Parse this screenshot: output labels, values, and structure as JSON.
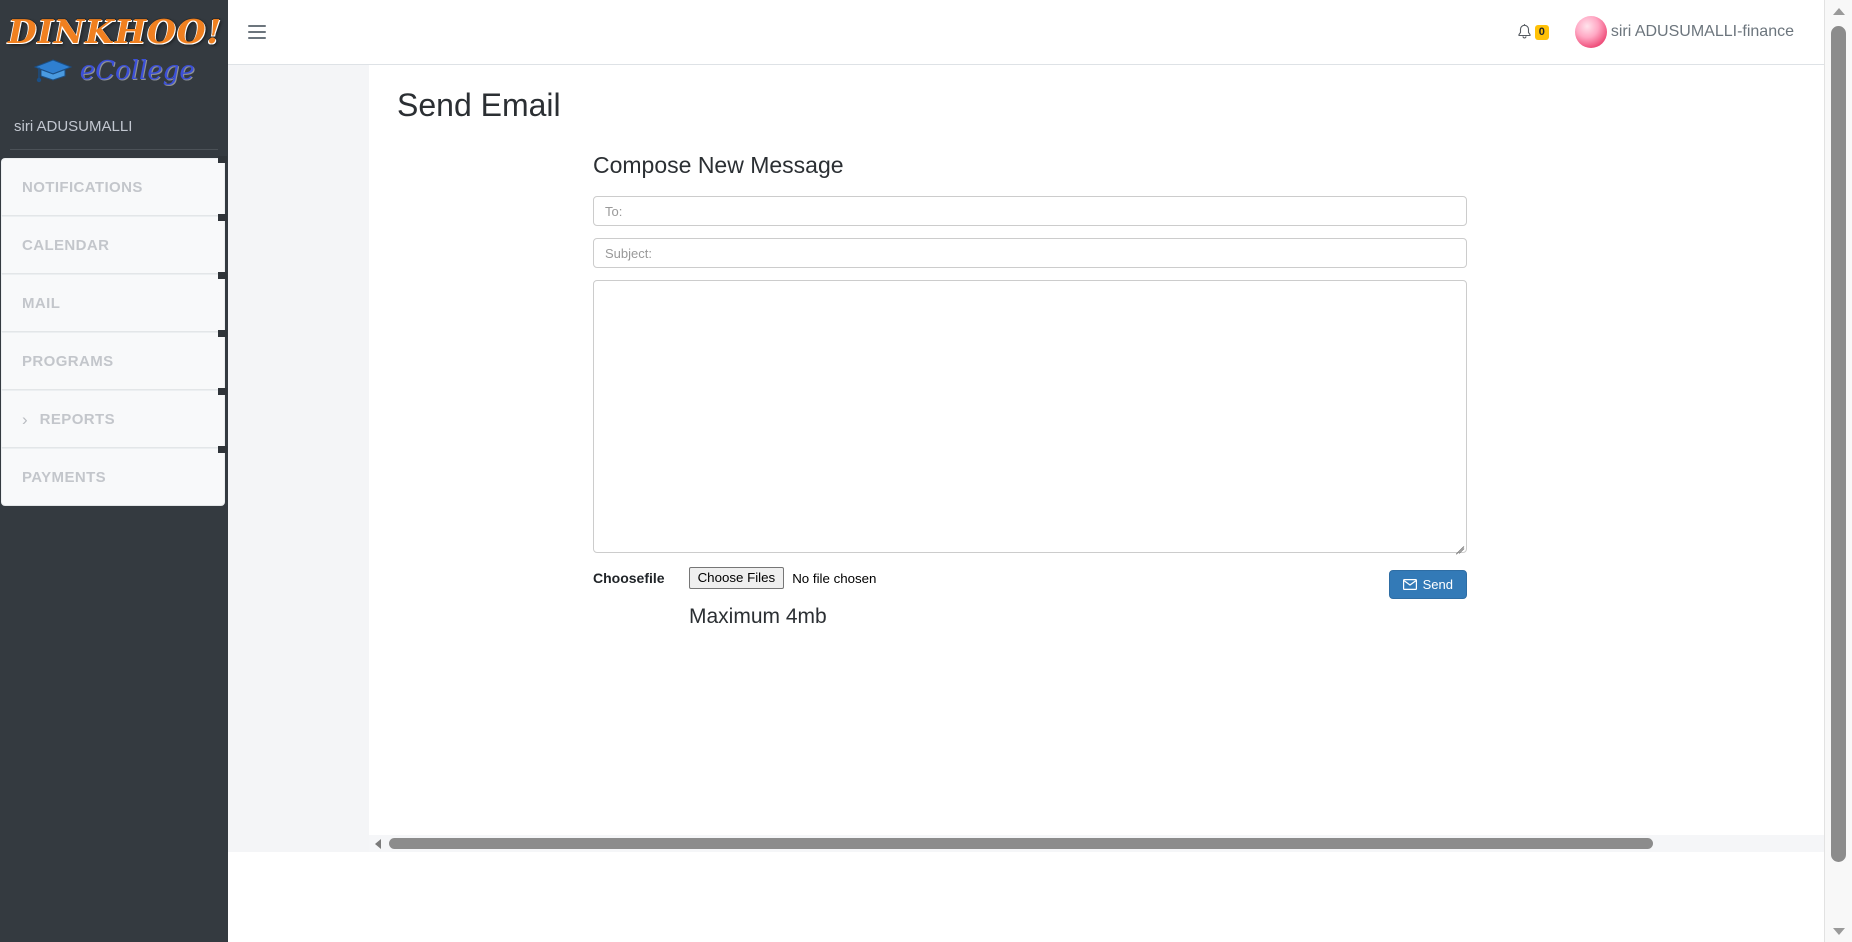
{
  "sidebar": {
    "logo": {
      "primary": "DINKHOO!",
      "secondary": "eCollege",
      "cap_icon": "graduation-cap-icon"
    },
    "user": "siri ADUSUMALLI",
    "items": [
      {
        "label": "NOTIFICATIONS",
        "chevron": ""
      },
      {
        "label": "CALENDAR",
        "chevron": ""
      },
      {
        "label": "MAIL",
        "chevron": ""
      },
      {
        "label": "PROGRAMS",
        "chevron": ""
      },
      {
        "label": "REPORTS",
        "chevron": "›"
      },
      {
        "label": "PAYMENTS",
        "chevron": ""
      }
    ]
  },
  "topbar": {
    "menu_icon": "hamburger-icon",
    "bell_icon": "bell-icon",
    "bell_count": "0",
    "avatar_icon": "user-avatar",
    "user_name": "siri ADUSUMALLI-finance"
  },
  "main": {
    "page_title": "Send Email",
    "compose_title": "Compose New Message",
    "to_placeholder": "To:",
    "to_value": "",
    "subject_placeholder": "Subject:",
    "subject_value": "",
    "message_value": "",
    "file_label": "Choosefile",
    "file_button": "Choose Files",
    "file_status": "No file chosen",
    "send_label": "Send",
    "send_icon": "envelope-icon",
    "max_note": "Maximum 4mb"
  },
  "colors": {
    "sidebar_bg": "#343a40",
    "nav_item_bg": "#f8f9fa",
    "primary_blue": "#337ab7",
    "badge_yellow": "#ffc107",
    "logo_orange": "#F08020",
    "logo_blue": "#3b4fd8",
    "content_bg": "#f4f5f7"
  }
}
